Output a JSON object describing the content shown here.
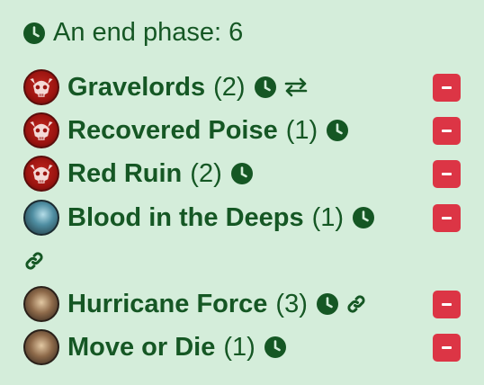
{
  "header": {
    "title": "An end phase: 6",
    "icon": "clock-icon"
  },
  "colors": {
    "background": "#d4edda",
    "text": "#155724",
    "remove_button": "#dc3545"
  },
  "rows": [
    {
      "name": "Gravelords",
      "count": "(2)",
      "avatar": "red-skull-emblem",
      "icons": [
        "clock-icon",
        "swap-icon"
      ]
    },
    {
      "name": "Recovered Poise",
      "count": "(1)",
      "avatar": "red-skull-emblem",
      "icons": [
        "clock-icon"
      ]
    },
    {
      "name": "Red Ruin",
      "count": "(2)",
      "avatar": "red-skull-emblem",
      "icons": [
        "clock-icon"
      ]
    },
    {
      "name": "Blood in the Deeps",
      "count": "(1)",
      "avatar": "teal-creature-portrait",
      "icons": [
        "clock-icon",
        "link-icon"
      ]
    },
    {
      "name": "Hurricane Force",
      "count": "(3)",
      "avatar": "warrior-portrait",
      "icons": [
        "clock-icon",
        "link-icon"
      ]
    },
    {
      "name": "Move or Die",
      "count": "(1)",
      "avatar": "warrior-portrait",
      "icons": [
        "clock-icon"
      ]
    }
  ]
}
